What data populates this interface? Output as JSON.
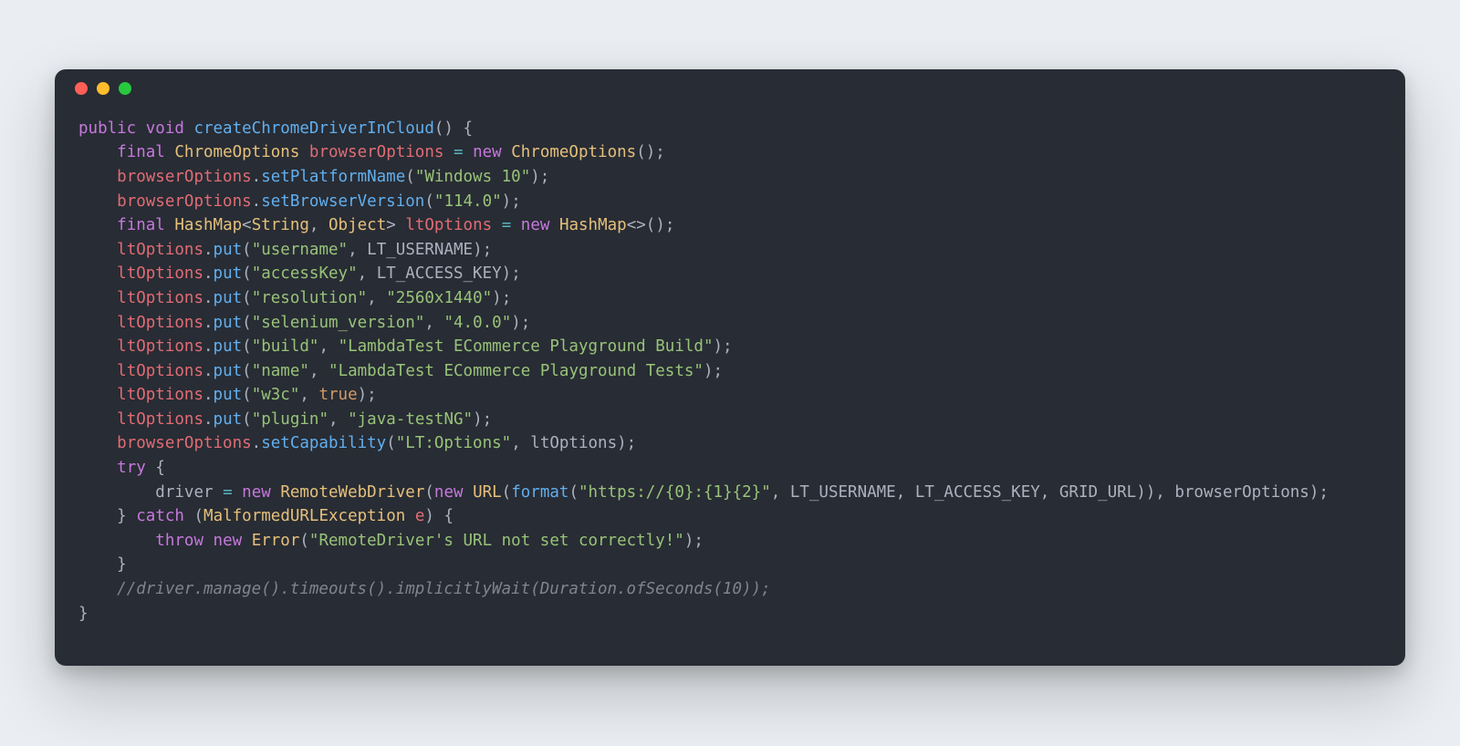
{
  "window": {
    "traffic_lights": [
      "close",
      "minimize",
      "zoom"
    ]
  },
  "code": {
    "language": "java",
    "method_signature": {
      "modifiers": "public void",
      "name": "createChromeDriverInCloud"
    },
    "chrome_options_var": "browserOptions",
    "chrome_options_class": "ChromeOptions",
    "platform_name": "Windows 10",
    "browser_version": "114.0",
    "lt_options_var": "ltOptions",
    "hashmap_type": "HashMap<String, Object>",
    "lt_options": {
      "username_key": "username",
      "username_val": "LT_USERNAME",
      "accesskey_key": "accessKey",
      "accesskey_val": "LT_ACCESS_KEY",
      "resolution_key": "resolution",
      "resolution_val": "2560x1440",
      "selenium_version_key": "selenium_version",
      "selenium_version_val": "4.0.0",
      "build_key": "build",
      "build_val": "LambdaTest ECommerce Playground Build",
      "name_key": "name",
      "name_val": "LambdaTest ECommerce Playground Tests",
      "w3c_key": "w3c",
      "w3c_val": "true",
      "plugin_key": "plugin",
      "plugin_val": "java-testNG"
    },
    "capability_key": "LT:Options",
    "remote": {
      "driver_var": "driver",
      "remote_class": "RemoteWebDriver",
      "url_class": "URL",
      "format_fn": "format",
      "url_template": "https://{0}:{1}{2}",
      "arg1": "LT_USERNAME",
      "arg2": "LT_ACCESS_KEY",
      "arg3": "GRID_URL"
    },
    "catch": {
      "exception_type": "MalformedURLException",
      "exception_var": "e",
      "throw_class": "Error",
      "throw_msg": "RemoteDriver's URL not set correctly!"
    },
    "comment": "//driver.manage().timeouts().implicitlyWait(Duration.ofSeconds(10));"
  }
}
